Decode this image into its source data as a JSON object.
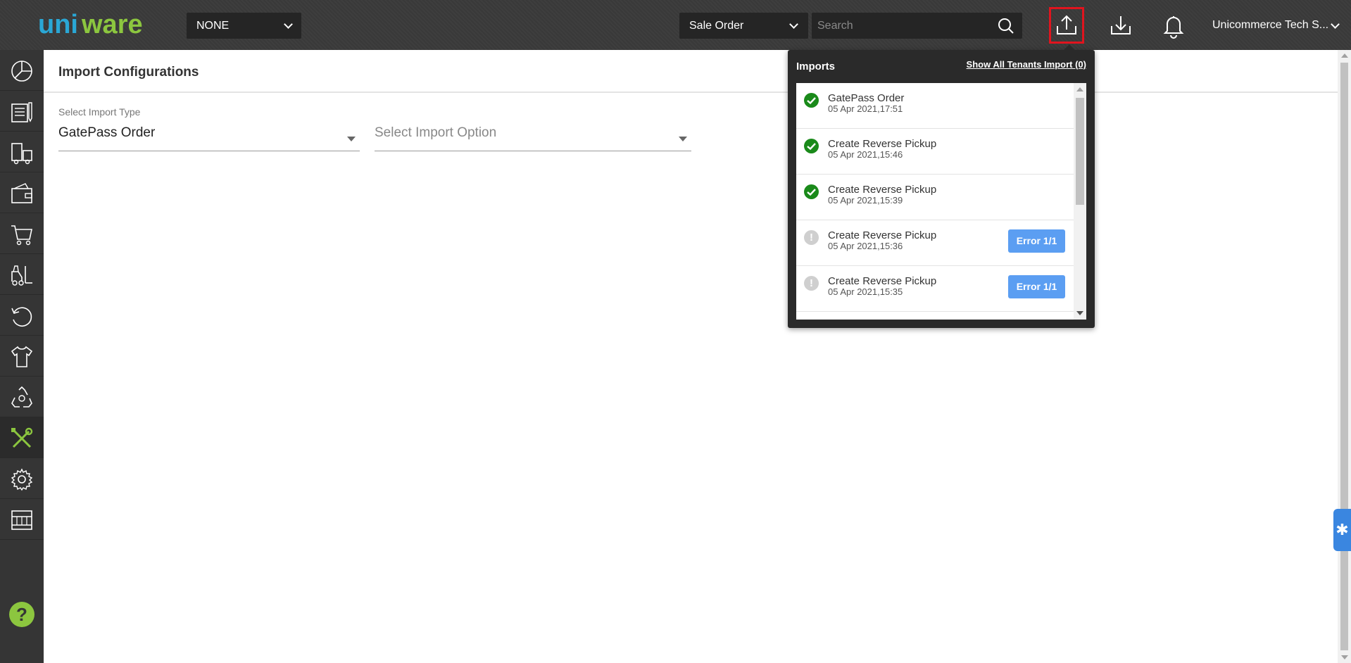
{
  "header": {
    "logo_text": "uniware",
    "tenant_select": "NONE",
    "entity_select": "Sale Order",
    "search_placeholder": "Search",
    "user_name": "Unicommerce Tech S..."
  },
  "colors": {
    "accent_green": "#8cc63f",
    "logo_blue": "#2aa7d5",
    "highlight_red": "#e0141e",
    "error_button": "#5b9ef2",
    "success": "#1a8a1a"
  },
  "sidebar": {
    "items": [
      {
        "icon": "dashboard-icon"
      },
      {
        "icon": "orders-icon"
      },
      {
        "icon": "shipping-icon"
      },
      {
        "icon": "wallet-icon"
      },
      {
        "icon": "cart-icon"
      },
      {
        "icon": "forklift-icon"
      },
      {
        "icon": "returns-icon"
      },
      {
        "icon": "product-icon"
      },
      {
        "icon": "recycle-icon"
      },
      {
        "icon": "tools-icon"
      },
      {
        "icon": "settings-icon"
      },
      {
        "icon": "warehouse-icon"
      }
    ],
    "help": "?"
  },
  "page": {
    "title": "Import Configurations",
    "import_type_label": "Select Import Type",
    "import_type_value": "GatePass Order",
    "import_option_placeholder": "Select Import Option"
  },
  "imports": {
    "title": "Imports",
    "show_all_link": "Show All Tenants Import (0)",
    "items": [
      {
        "name": "GatePass Order",
        "time": "05 Apr 2021,17:51",
        "status": "success"
      },
      {
        "name": "Create Reverse Pickup",
        "time": "05 Apr 2021,15:46",
        "status": "success"
      },
      {
        "name": "Create Reverse Pickup",
        "time": "05 Apr 2021,15:39",
        "status": "success"
      },
      {
        "name": "Create Reverse Pickup",
        "time": "05 Apr 2021,15:36",
        "status": "error",
        "error_label": "Error 1/1"
      },
      {
        "name": "Create Reverse Pickup",
        "time": "05 Apr 2021,15:35",
        "status": "error",
        "error_label": "Error 1/1"
      }
    ]
  }
}
